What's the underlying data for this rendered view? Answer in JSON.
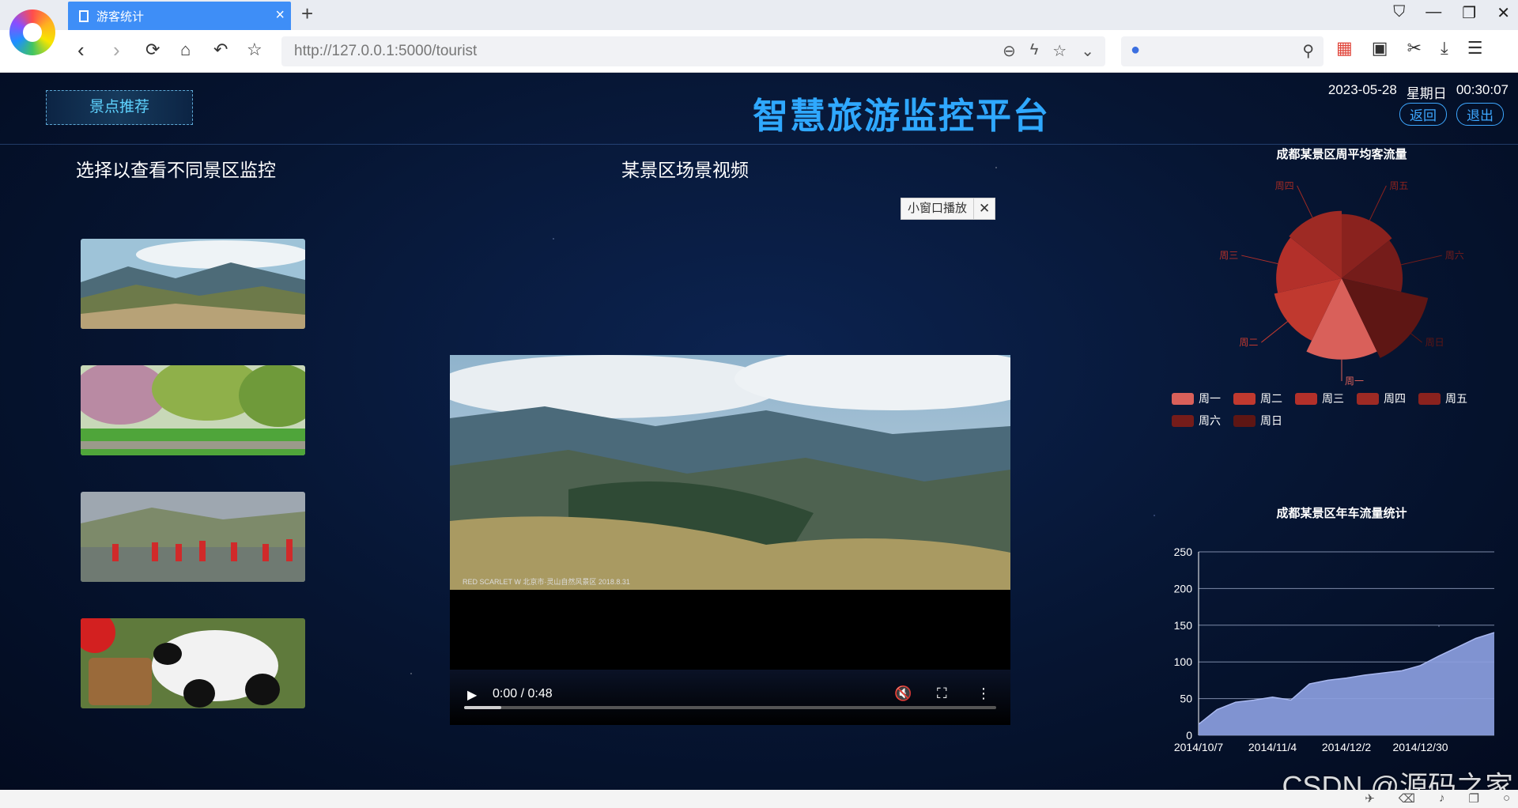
{
  "browser": {
    "tab_title": "游客统计",
    "url": "http://127.0.0.1:5000/tourist"
  },
  "header": {
    "reco_button": "景点推荐",
    "title": "智慧旅游监控平台",
    "date": "2023-05-28",
    "weekday": "星期日",
    "time": "00:30:07",
    "back_button": "返回",
    "logout_button": "退出"
  },
  "left": {
    "title": "选择以查看不同景区监控"
  },
  "center": {
    "title": "某景区场景视频",
    "mini_player_label": "小窗口播放",
    "video_caption": "RED SCARLET W 北京市·灵山自然风景区 2018.8.31",
    "time": "0:00 / 0:48",
    "progress": 0.07
  },
  "pie": {
    "title": "成都某景区周平均客流量",
    "legend": [
      "周一",
      "周二",
      "周三",
      "周四",
      "周五",
      "周六",
      "周日"
    ],
    "colors": [
      "#d9605a",
      "#c0392f",
      "#b3302a",
      "#9e2a24",
      "#8a221e",
      "#751c1a",
      "#5e1614"
    ]
  },
  "line": {
    "title": "成都某景区年车流量统计",
    "color": "#8b9ee0"
  },
  "chart_data": [
    {
      "type": "pie",
      "title": "成都某景区周平均客流量",
      "categories": [
        "周一",
        "周二",
        "周三",
        "周四",
        "周五",
        "周六",
        "周日"
      ],
      "values": [
        80,
        58,
        52,
        55,
        50,
        45,
        95
      ]
    },
    {
      "type": "area",
      "title": "成都某景区年车流量统计",
      "x": [
        "2014/10/7",
        "2014/10/14",
        "2014/10/21",
        "2014/10/28",
        "2014/11/4",
        "2014/11/11",
        "2014/11/18",
        "2014/11/25",
        "2014/12/2",
        "2014/12/9",
        "2014/12/16",
        "2014/12/23",
        "2014/12/30",
        "2015/1/6",
        "2015/1/13",
        "2015/1/20",
        "2015/1/27"
      ],
      "y": [
        15,
        35,
        45,
        48,
        52,
        48,
        70,
        75,
        78,
        82,
        85,
        88,
        95,
        108,
        120,
        132,
        140
      ],
      "xticks": [
        "2014/10/7",
        "2014/11/4",
        "2014/12/2",
        "2014/12/30"
      ],
      "ylim": [
        0,
        250
      ],
      "yticks": [
        0,
        50,
        100,
        150,
        200,
        250
      ],
      "grid": true
    }
  ],
  "footer": {
    "watermark": "CSDN @源码之家"
  }
}
